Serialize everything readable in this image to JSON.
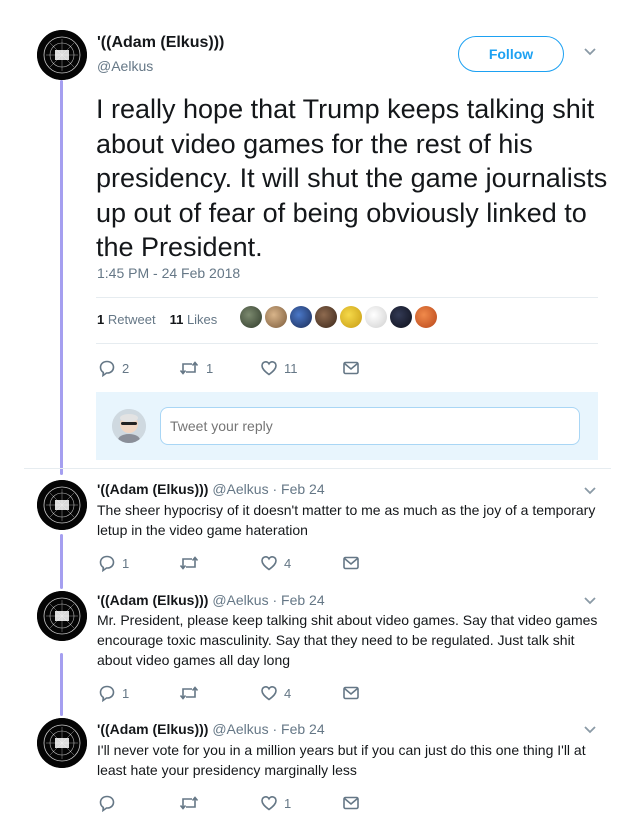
{
  "main_tweet": {
    "author_name": "'((Adam (Elkus)))",
    "author_handle": "@Aelkus",
    "follow_label": "Follow",
    "text": "I really hope that Trump keeps talking shit about video games for the rest of his presidency. It will shut the game journalists up out of fear of being obviously linked to the President.",
    "timestamp": "1:45 PM - 24 Feb 2018",
    "retweets_count": "1",
    "retweets_label": "Retweet",
    "likes_count": "11",
    "likes_label": "Likes",
    "actions": {
      "replies": "2",
      "retweets": "1",
      "likes": "11"
    }
  },
  "reply_composer": {
    "placeholder": "Tweet your reply"
  },
  "replies": [
    {
      "name": "'((Adam (Elkus)))",
      "handle": "@Aelkus",
      "separator": "·",
      "date": "Feb 24",
      "text": "The sheer hypocrisy of it doesn't matter to me as much as the joy of a temporary letup in the video game hateration",
      "reply_count": "1",
      "retweet_count": "",
      "like_count": "4"
    },
    {
      "name": "'((Adam (Elkus)))",
      "handle": "@Aelkus",
      "separator": "·",
      "date": "Feb 24",
      "text": "Mr. President, please keep talking shit about video games. Say that video games encourage toxic masculinity. Say that they need to be regulated. Just talk shit about video games all day long",
      "reply_count": "1",
      "retweet_count": "",
      "like_count": "4"
    },
    {
      "name": "'((Adam (Elkus)))",
      "handle": "@Aelkus",
      "separator": "·",
      "date": "Feb 24",
      "text": "I'll never vote for you in a million years but if you can just do this one thing I'll at least hate your presidency marginally less",
      "reply_count": "",
      "retweet_count": "",
      "like_count": "1"
    }
  ],
  "icons": {
    "reply": "reply-icon",
    "retweet": "retweet-icon",
    "like": "heart-icon",
    "message": "envelope-icon",
    "menu": "chevron-down-icon"
  },
  "colors": {
    "accent": "#1da1f2",
    "thread_line": "#a59ff0",
    "secondary_text": "#657786",
    "reply_box_bg": "#e8f5fd"
  }
}
